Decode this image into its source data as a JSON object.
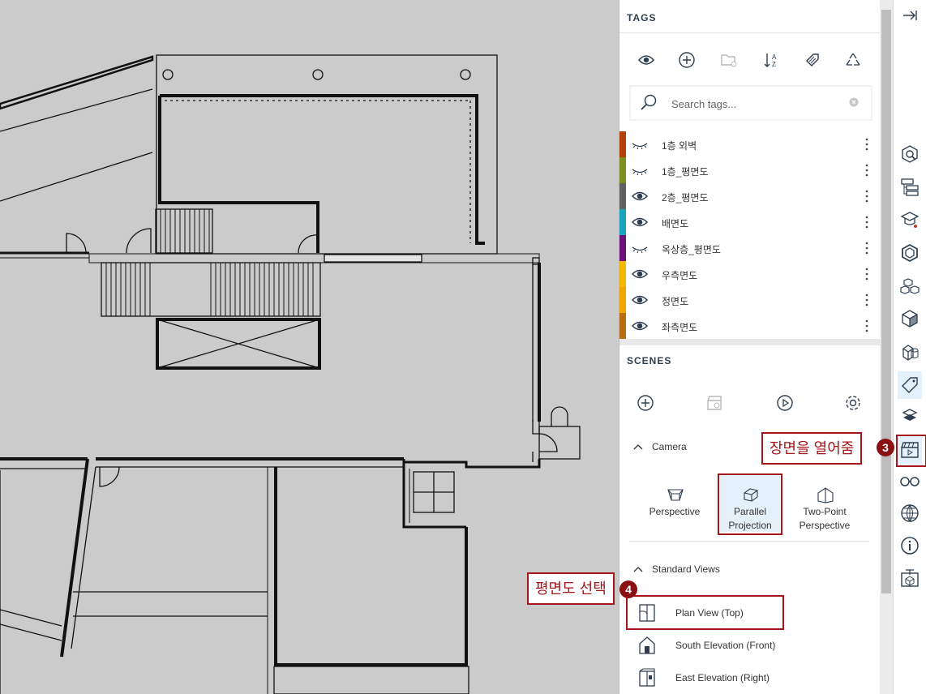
{
  "tags": {
    "title": "TAGS",
    "toolbar": [
      "eye-icon",
      "add-icon",
      "folder-icon",
      "sort-az-icon",
      "tag-color-icon",
      "purge-icon"
    ],
    "search_placeholder": "Search tags...",
    "items": [
      {
        "name": "1층 외벽",
        "color": "#b5400a",
        "visible": false
      },
      {
        "name": "1층_평면도",
        "color": "#7d8d1e",
        "visible": false
      },
      {
        "name": "2층_평면도",
        "color": "#616161",
        "visible": true
      },
      {
        "name": "배면도",
        "color": "#17a6b8",
        "visible": true
      },
      {
        "name": "옥상층_평면도",
        "color": "#6b1278",
        "visible": false
      },
      {
        "name": "우측면도",
        "color": "#f2b700",
        "visible": true
      },
      {
        "name": "정면도",
        "color": "#f0a400",
        "visible": true
      },
      {
        "name": "좌측면도",
        "color": "#b76d12",
        "visible": true
      }
    ]
  },
  "scenes": {
    "title": "SCENES",
    "toolbar": [
      "add-icon",
      "update-scene-icon",
      "play-icon",
      "settings-icon"
    ],
    "camera_label": "Camera",
    "camera_options": [
      {
        "label_1": "Perspective",
        "label_2": "",
        "selected": false
      },
      {
        "label_1": "Parallel",
        "label_2": "Projection",
        "selected": true
      },
      {
        "label_1": "Two-Point",
        "label_2": "Perspective",
        "selected": false
      }
    ],
    "standard_views_label": "Standard Views",
    "standard_views": [
      "Plan View (Top)",
      "South Elevation (Front)",
      "East Elevation (Right)"
    ]
  },
  "callouts": {
    "step3_text": "장면을 열어줌",
    "step3_num": "3",
    "step4_text": "평면도 선택",
    "step4_num": "4"
  },
  "rail": {
    "collapse": "collapse-arrow-icon",
    "icons": [
      "entity-info-icon",
      "outliner-icon",
      "instructor-icon",
      "components-icon",
      "materials-icon",
      "styles-icon",
      "solid-tools-icon",
      "tags-icon",
      "display-icon",
      "scenes-icon",
      "glasses-icon",
      "geo-location-icon",
      "model-info-icon",
      "3d-warehouse-icon"
    ]
  },
  "colors": {
    "accent_red": "#a4161a",
    "panel_bg": "#ffffff",
    "canvas_bg": "#cbcbcb"
  }
}
